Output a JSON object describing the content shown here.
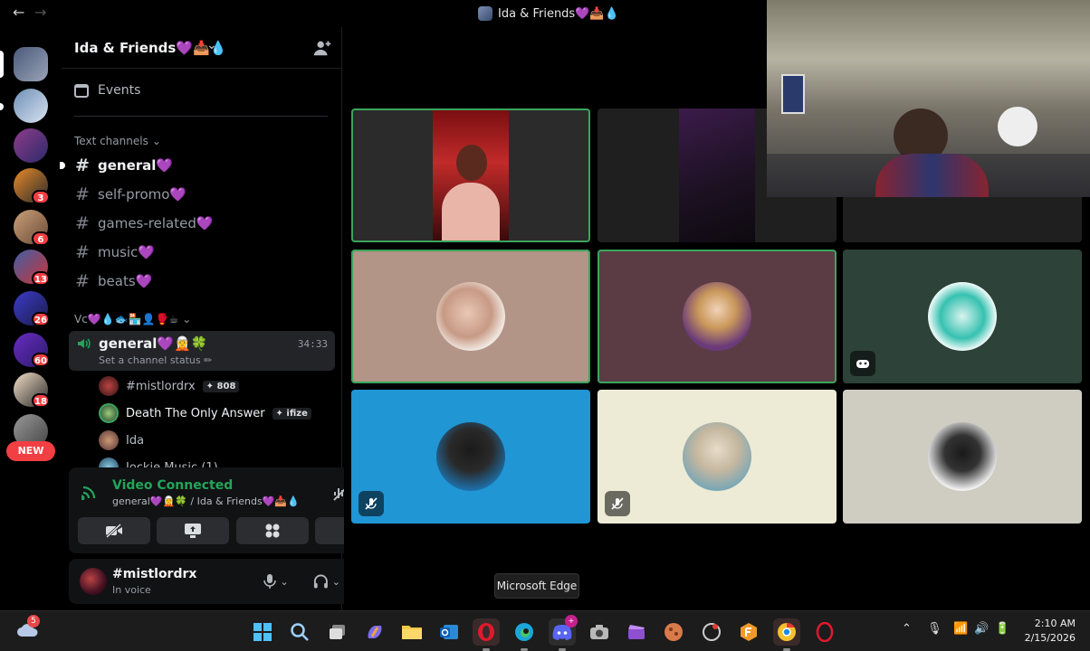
{
  "window": {
    "title": "Ida & Friends💜📥💧"
  },
  "server": {
    "name": "Ida & Friends💜📥💧",
    "events_label": "Events"
  },
  "text_category": {
    "label": "Text channels"
  },
  "text_channels": [
    {
      "name": "general💜",
      "active": true
    },
    {
      "name": "self-promo💜",
      "active": false
    },
    {
      "name": "games-related💜",
      "active": false
    },
    {
      "name": "music💜",
      "active": false
    },
    {
      "name": "beats💜",
      "active": false
    }
  ],
  "vc_category": {
    "label": "Vc💜💧🐟🏪👤🥊☕"
  },
  "voice_channel": {
    "name": "general💜🧝🍀",
    "status": "Set a channel status ✏",
    "timer": "34:33"
  },
  "voice_users": [
    {
      "name": "#mistlordrx",
      "tag": "✦ 808"
    },
    {
      "name": "Death The Only Answer",
      "tag": "✦ ifize"
    },
    {
      "name": "Ida",
      "tag": ""
    },
    {
      "name": "Jockie Music (1)",
      "tag": ""
    }
  ],
  "voice_panel": {
    "title": "Video Connected",
    "subtitle": "general💜🧝🍀 / Ida & Friends💜📥💧"
  },
  "user": {
    "name": "#mistlordrx",
    "status": "In voice"
  },
  "server_badges": [
    "3",
    "6",
    "13",
    "26",
    "60",
    "18"
  ],
  "new_badge": "NEW",
  "tooltip": "Microsoft Edge",
  "clock": {
    "time": "2:10 AM",
    "date": "2/15/2026"
  },
  "weather_badge": "5",
  "colors": {
    "accent_green": "#3ba55c",
    "badge_red": "#f23f43"
  }
}
